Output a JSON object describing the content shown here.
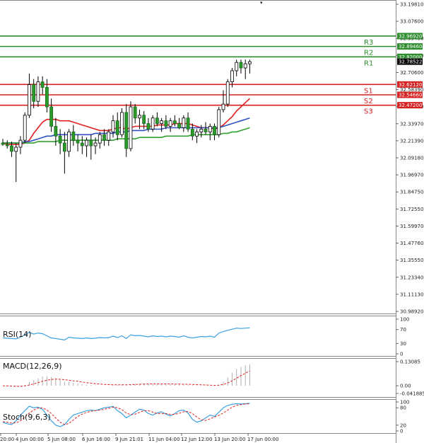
{
  "chart_data": {
    "type": "candlestick",
    "price_axis": {
      "ticks": [
        "33.19810",
        "33.07600",
        "32.95400",
        "32.83200",
        "32.70600",
        "32.58390",
        "32.46180",
        "32.33970",
        "32.21390",
        "32.09180",
        "31.96970",
        "31.84750",
        "31.72550",
        "31.59970",
        "31.47760",
        "31.35550",
        "31.23340",
        "31.11130",
        "30.98920"
      ]
    },
    "levels": [
      {
        "name": "R3",
        "value": 32.9692,
        "tag": "32.96920",
        "color": "#2e8b2e"
      },
      {
        "name": "R2",
        "value": 32.8946,
        "tag": "32.89460",
        "color": "#2e8b2e"
      },
      {
        "name": "R1",
        "value": 32.82,
        "tag": "32.82000",
        "color": "#2e8b2e"
      },
      {
        "name": "S1",
        "value": 32.6212,
        "tag": "32.62120",
        "color": "#d42020"
      },
      {
        "name": "S2",
        "value": 32.5466,
        "tag": "32.54660",
        "color": "#d42020"
      },
      {
        "name": "S3",
        "value": 32.472,
        "tag": "32.47200",
        "color": "#d42020"
      }
    ],
    "current_price": {
      "value": 32.78522,
      "tag": "32.78522",
      "color": "#000000"
    },
    "time_labels": [
      "20:00",
      "4 Jun 00:00",
      "5 Jun 08:00",
      "6 Jun 16:00",
      "9 Jun 21:01",
      "11 Jun 04:00",
      "12 Jun 12:00",
      "13 Jun 20:00",
      "17 Jun 00:00"
    ],
    "candles": [
      [
        32.2,
        32.23,
        32.18,
        32.19
      ],
      [
        32.19,
        32.22,
        32.16,
        32.18
      ],
      [
        32.18,
        32.21,
        32.1,
        32.14
      ],
      [
        32.14,
        32.2,
        31.92,
        32.17
      ],
      [
        32.17,
        32.25,
        32.12,
        32.22
      ],
      [
        32.22,
        32.42,
        32.2,
        32.4
      ],
      [
        32.4,
        32.7,
        32.38,
        32.62
      ],
      [
        32.62,
        32.66,
        32.45,
        32.5
      ],
      [
        32.5,
        32.68,
        32.46,
        32.64
      ],
      [
        32.64,
        32.68,
        32.55,
        32.6
      ],
      [
        32.6,
        32.66,
        32.42,
        32.46
      ],
      [
        32.46,
        32.52,
        32.28,
        32.32
      ],
      [
        32.32,
        32.38,
        32.18,
        32.25
      ],
      [
        32.25,
        32.3,
        32.12,
        32.2
      ],
      [
        32.2,
        32.28,
        31.98,
        32.14
      ],
      [
        32.14,
        32.3,
        32.1,
        32.28
      ],
      [
        32.28,
        32.33,
        32.18,
        32.22
      ],
      [
        32.22,
        32.26,
        32.14,
        32.2
      ],
      [
        32.2,
        32.25,
        32.12,
        32.18
      ],
      [
        32.18,
        32.24,
        32.1,
        32.22
      ],
      [
        32.22,
        32.26,
        32.08,
        32.18
      ],
      [
        32.18,
        32.24,
        32.12,
        32.2
      ],
      [
        32.2,
        32.28,
        32.16,
        32.26
      ],
      [
        32.26,
        32.3,
        32.18,
        32.22
      ],
      [
        32.22,
        32.3,
        32.18,
        32.28
      ],
      [
        32.28,
        32.4,
        32.24,
        32.36
      ],
      [
        32.36,
        32.42,
        32.22,
        32.26
      ],
      [
        32.26,
        32.45,
        32.24,
        32.42
      ],
      [
        32.42,
        32.48,
        32.1,
        32.16
      ],
      [
        32.16,
        32.5,
        32.14,
        32.46
      ],
      [
        32.46,
        32.48,
        32.34,
        32.38
      ],
      [
        32.38,
        32.44,
        32.3,
        32.4
      ],
      [
        32.4,
        32.43,
        32.3,
        32.34
      ],
      [
        32.34,
        32.38,
        32.28,
        32.3
      ],
      [
        32.3,
        32.4,
        32.28,
        32.38
      ],
      [
        32.38,
        32.42,
        32.32,
        32.34
      ],
      [
        32.34,
        32.38,
        32.28,
        32.36
      ],
      [
        32.36,
        32.4,
        32.3,
        32.32
      ],
      [
        32.32,
        32.38,
        32.28,
        32.36
      ],
      [
        32.36,
        32.4,
        32.32,
        32.34
      ],
      [
        32.34,
        32.38,
        32.3,
        32.31
      ],
      [
        32.31,
        32.4,
        32.28,
        32.38
      ],
      [
        32.38,
        32.42,
        32.28,
        32.3
      ],
      [
        32.3,
        32.34,
        32.22,
        32.25
      ],
      [
        32.25,
        32.3,
        32.2,
        32.28
      ],
      [
        32.28,
        32.33,
        32.24,
        32.3
      ],
      [
        32.3,
        32.35,
        32.26,
        32.28
      ],
      [
        32.28,
        32.34,
        32.22,
        32.32
      ],
      [
        32.32,
        32.34,
        32.22,
        32.26
      ],
      [
        32.26,
        32.46,
        32.24,
        32.44
      ],
      [
        32.44,
        32.58,
        32.42,
        32.48
      ],
      [
        32.48,
        32.66,
        32.46,
        32.64
      ],
      [
        32.64,
        32.74,
        32.6,
        32.72
      ],
      [
        32.72,
        32.8,
        32.68,
        32.78
      ],
      [
        32.78,
        32.8,
        32.7,
        32.74
      ],
      [
        32.74,
        32.8,
        32.66,
        32.77
      ],
      [
        32.77,
        32.8,
        32.7,
        32.785
      ]
    ],
    "moving_averages": [
      {
        "color": "#e02020",
        "values": [
          32.2,
          32.19,
          32.19,
          32.19,
          32.19,
          32.2,
          32.22,
          32.27,
          32.31,
          32.35,
          32.37,
          32.37,
          32.37,
          32.36,
          32.36,
          32.36,
          32.35,
          32.34,
          32.33,
          32.32,
          32.31,
          32.3,
          32.29,
          32.29,
          32.29,
          32.3,
          32.31,
          32.31,
          32.3,
          32.31,
          32.32,
          32.32,
          32.32,
          32.32,
          32.32,
          32.33,
          32.33,
          32.33,
          32.33,
          32.34,
          32.34,
          32.34,
          32.34,
          32.33,
          32.32,
          32.31,
          32.31,
          32.31,
          32.3,
          32.31,
          32.33,
          32.36,
          32.39,
          32.43,
          32.46,
          32.49,
          32.52
        ]
      },
      {
        "color": "#3050c0",
        "values": [
          32.2,
          32.2,
          32.2,
          32.2,
          32.2,
          32.21,
          32.21,
          32.22,
          32.23,
          32.24,
          32.25,
          32.25,
          32.26,
          32.26,
          32.26,
          32.26,
          32.26,
          32.26,
          32.26,
          32.26,
          32.26,
          32.27,
          32.27,
          32.27,
          32.27,
          32.27,
          32.28,
          32.28,
          32.28,
          32.29,
          32.29,
          32.29,
          32.29,
          32.3,
          32.3,
          32.3,
          32.3,
          32.31,
          32.31,
          32.31,
          32.31,
          32.31,
          32.31,
          32.31,
          32.31,
          32.31,
          32.31,
          32.31,
          32.31,
          32.31,
          32.32,
          32.33,
          32.34,
          32.35,
          32.36,
          32.37,
          32.38
        ]
      },
      {
        "color": "#30a030",
        "values": [
          32.2,
          32.2,
          32.2,
          32.2,
          32.2,
          32.2,
          32.2,
          32.2,
          32.21,
          32.21,
          32.21,
          32.21,
          32.21,
          32.22,
          32.22,
          32.22,
          32.22,
          32.22,
          32.22,
          32.22,
          32.22,
          32.22,
          32.22,
          32.22,
          32.22,
          32.22,
          32.23,
          32.23,
          32.23,
          32.23,
          32.23,
          32.24,
          32.24,
          32.24,
          32.24,
          32.24,
          32.24,
          32.25,
          32.25,
          32.25,
          32.25,
          32.25,
          32.25,
          32.26,
          32.26,
          32.26,
          32.26,
          32.26,
          32.26,
          32.26,
          32.27,
          32.27,
          32.28,
          32.28,
          32.29,
          32.3,
          32.31
        ]
      }
    ],
    "rsi": {
      "title": "RSI(14)",
      "ticks": [
        "100",
        "70",
        "30",
        "0"
      ],
      "values": [
        46,
        45,
        44,
        43,
        48,
        55,
        62,
        57,
        60,
        58,
        52,
        46,
        44,
        42,
        40,
        48,
        46,
        45,
        44,
        46,
        44,
        45,
        47,
        46,
        47,
        51,
        47,
        52,
        44,
        55,
        52,
        53,
        51,
        49,
        52,
        50,
        51,
        49,
        51,
        50,
        48,
        52,
        48,
        46,
        48,
        50,
        49,
        51,
        48,
        60,
        64,
        68,
        71,
        74,
        73,
        74,
        75
      ]
    },
    "macd": {
      "title": "MACD(12,26,9)",
      "ticks": [
        "0.13085",
        "0.00",
        "-0.041885"
      ],
      "histogram": [
        0.0,
        -0.002,
        -0.004,
        -0.006,
        -0.004,
        0.004,
        0.02,
        0.03,
        0.04,
        0.05,
        0.052,
        0.048,
        0.04,
        0.032,
        0.022,
        0.02,
        0.016,
        0.012,
        0.008,
        0.006,
        0.004,
        0.002,
        0.001,
        0.0,
        0.0,
        0.003,
        0.004,
        0.006,
        0.002,
        0.008,
        0.01,
        0.012,
        0.012,
        0.01,
        0.01,
        0.01,
        0.01,
        0.009,
        0.009,
        0.008,
        0.007,
        0.007,
        0.006,
        0.004,
        0.002,
        0.001,
        0.0,
        0.0,
        -0.002,
        0.006,
        0.022,
        0.045,
        0.07,
        0.09,
        0.102,
        0.11,
        0.116
      ],
      "signal": [
        0.0,
        -0.001,
        -0.002,
        -0.003,
        -0.003,
        -0.001,
        0.004,
        0.01,
        0.017,
        0.024,
        0.03,
        0.034,
        0.036,
        0.035,
        0.033,
        0.03,
        0.027,
        0.024,
        0.02,
        0.017,
        0.014,
        0.011,
        0.009,
        0.007,
        0.006,
        0.005,
        0.005,
        0.005,
        0.005,
        0.006,
        0.007,
        0.008,
        0.009,
        0.01,
        0.01,
        0.01,
        0.01,
        0.01,
        0.01,
        0.009,
        0.009,
        0.008,
        0.008,
        0.007,
        0.006,
        0.005,
        0.004,
        0.003,
        0.002,
        0.003,
        0.007,
        0.015,
        0.027,
        0.041,
        0.055,
        0.068,
        0.08
      ]
    },
    "stoch": {
      "title": "Stoch(9,6,3)",
      "ticks": [
        "100",
        "80",
        "20",
        "0"
      ],
      "main": [
        30,
        25,
        22,
        35,
        55,
        70,
        85,
        80,
        82,
        75,
        55,
        35,
        20,
        15,
        22,
        40,
        55,
        60,
        65,
        70,
        72,
        70,
        75,
        80,
        82,
        85,
        70,
        60,
        45,
        55,
        65,
        75,
        72,
        60,
        55,
        62,
        66,
        58,
        52,
        60,
        70,
        72,
        62,
        40,
        30,
        35,
        45,
        55,
        50,
        65,
        80,
        88,
        92,
        94,
        93,
        94,
        95
      ],
      "signal": [
        32,
        30,
        27,
        28,
        35,
        48,
        62,
        72,
        79,
        80,
        72,
        60,
        45,
        30,
        22,
        26,
        38,
        50,
        58,
        64,
        68,
        70,
        72,
        75,
        78,
        82,
        80,
        74,
        62,
        56,
        58,
        64,
        70,
        70,
        65,
        60,
        60,
        60,
        57,
        57,
        61,
        66,
        67,
        60,
        48,
        38,
        36,
        42,
        48,
        54,
        62,
        72,
        82,
        88,
        91,
        93,
        94
      ]
    }
  }
}
